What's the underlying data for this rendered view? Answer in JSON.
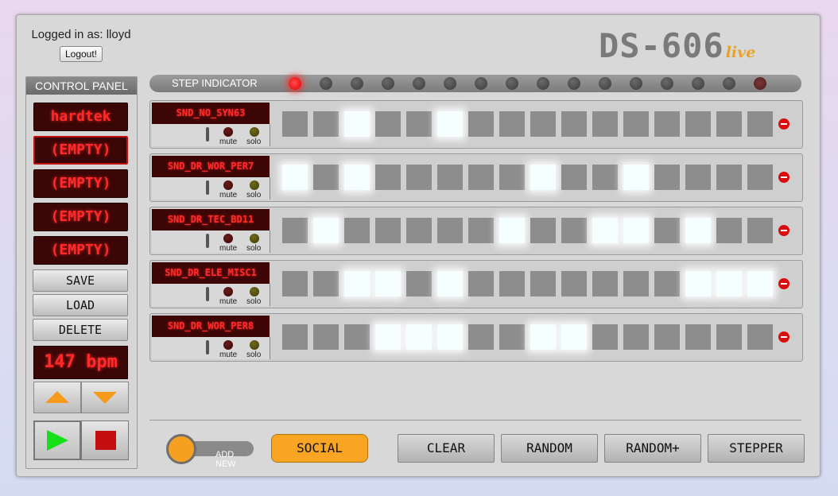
{
  "header": {
    "login_text": "Logged in as: lloyd",
    "logout_label": "Logout!",
    "logo_main": "DS-606",
    "logo_suffix": "live"
  },
  "control_panel": {
    "title": "CONTROL PANEL",
    "slots": [
      "hardtek",
      "(EMPTY)",
      "(EMPTY)",
      "(EMPTY)",
      "(EMPTY)"
    ],
    "selected_slot": 1,
    "save_label": "SAVE",
    "load_label": "LOAD",
    "delete_label": "DELETE",
    "bpm": "147 bpm",
    "up_icon": "triangle-up",
    "down_icon": "triangle-down",
    "play_icon": "play",
    "stop_icon": "stop"
  },
  "step_indicator": {
    "label": "STEP INDICATOR",
    "active_step": 0,
    "dim_step": 15,
    "step_count": 16
  },
  "tracks": [
    {
      "name": "SND_NO_SYN63",
      "steps": [
        0,
        0,
        1,
        0,
        0,
        1,
        0,
        0,
        0,
        0,
        0,
        0,
        0,
        0,
        0,
        0
      ],
      "mute_label": "mute",
      "solo_label": "solo"
    },
    {
      "name": "SND_DR_WOR_PER7",
      "steps": [
        1,
        0,
        1,
        0,
        0,
        0,
        0,
        0,
        1,
        0,
        0,
        1,
        0,
        0,
        0,
        0
      ],
      "mute_label": "mute",
      "solo_label": "solo"
    },
    {
      "name": "SND_DR_TEC_BD11",
      "steps": [
        0,
        1,
        0,
        0,
        0,
        0,
        0,
        1,
        0,
        0,
        1,
        1,
        0,
        1,
        0,
        0
      ],
      "mute_label": "mute",
      "solo_label": "solo"
    },
    {
      "name": "SND_DR_ELE_MISC1",
      "steps": [
        0,
        0,
        1,
        1,
        0,
        1,
        0,
        0,
        0,
        0,
        0,
        0,
        0,
        1,
        1,
        1
      ],
      "mute_label": "mute",
      "solo_label": "solo"
    },
    {
      "name": "SND_DR_WOR_PER8",
      "steps": [
        0,
        0,
        0,
        1,
        1,
        1,
        0,
        0,
        1,
        1,
        0,
        0,
        0,
        0,
        0,
        0
      ],
      "mute_label": "mute",
      "solo_label": "solo"
    }
  ],
  "bottom": {
    "add_new_label": "ADD NEW",
    "social_label": "SOCIAL",
    "clear_label": "CLEAR",
    "random_label": "RANDOM",
    "random_plus_label": "RANDOM+",
    "stepper_label": "STEPPER"
  },
  "colors": {
    "accent": "#f7a522",
    "led_red": "#ff2a2a",
    "step_on": "#f5ffff",
    "step_off": "#8d8d8d"
  }
}
